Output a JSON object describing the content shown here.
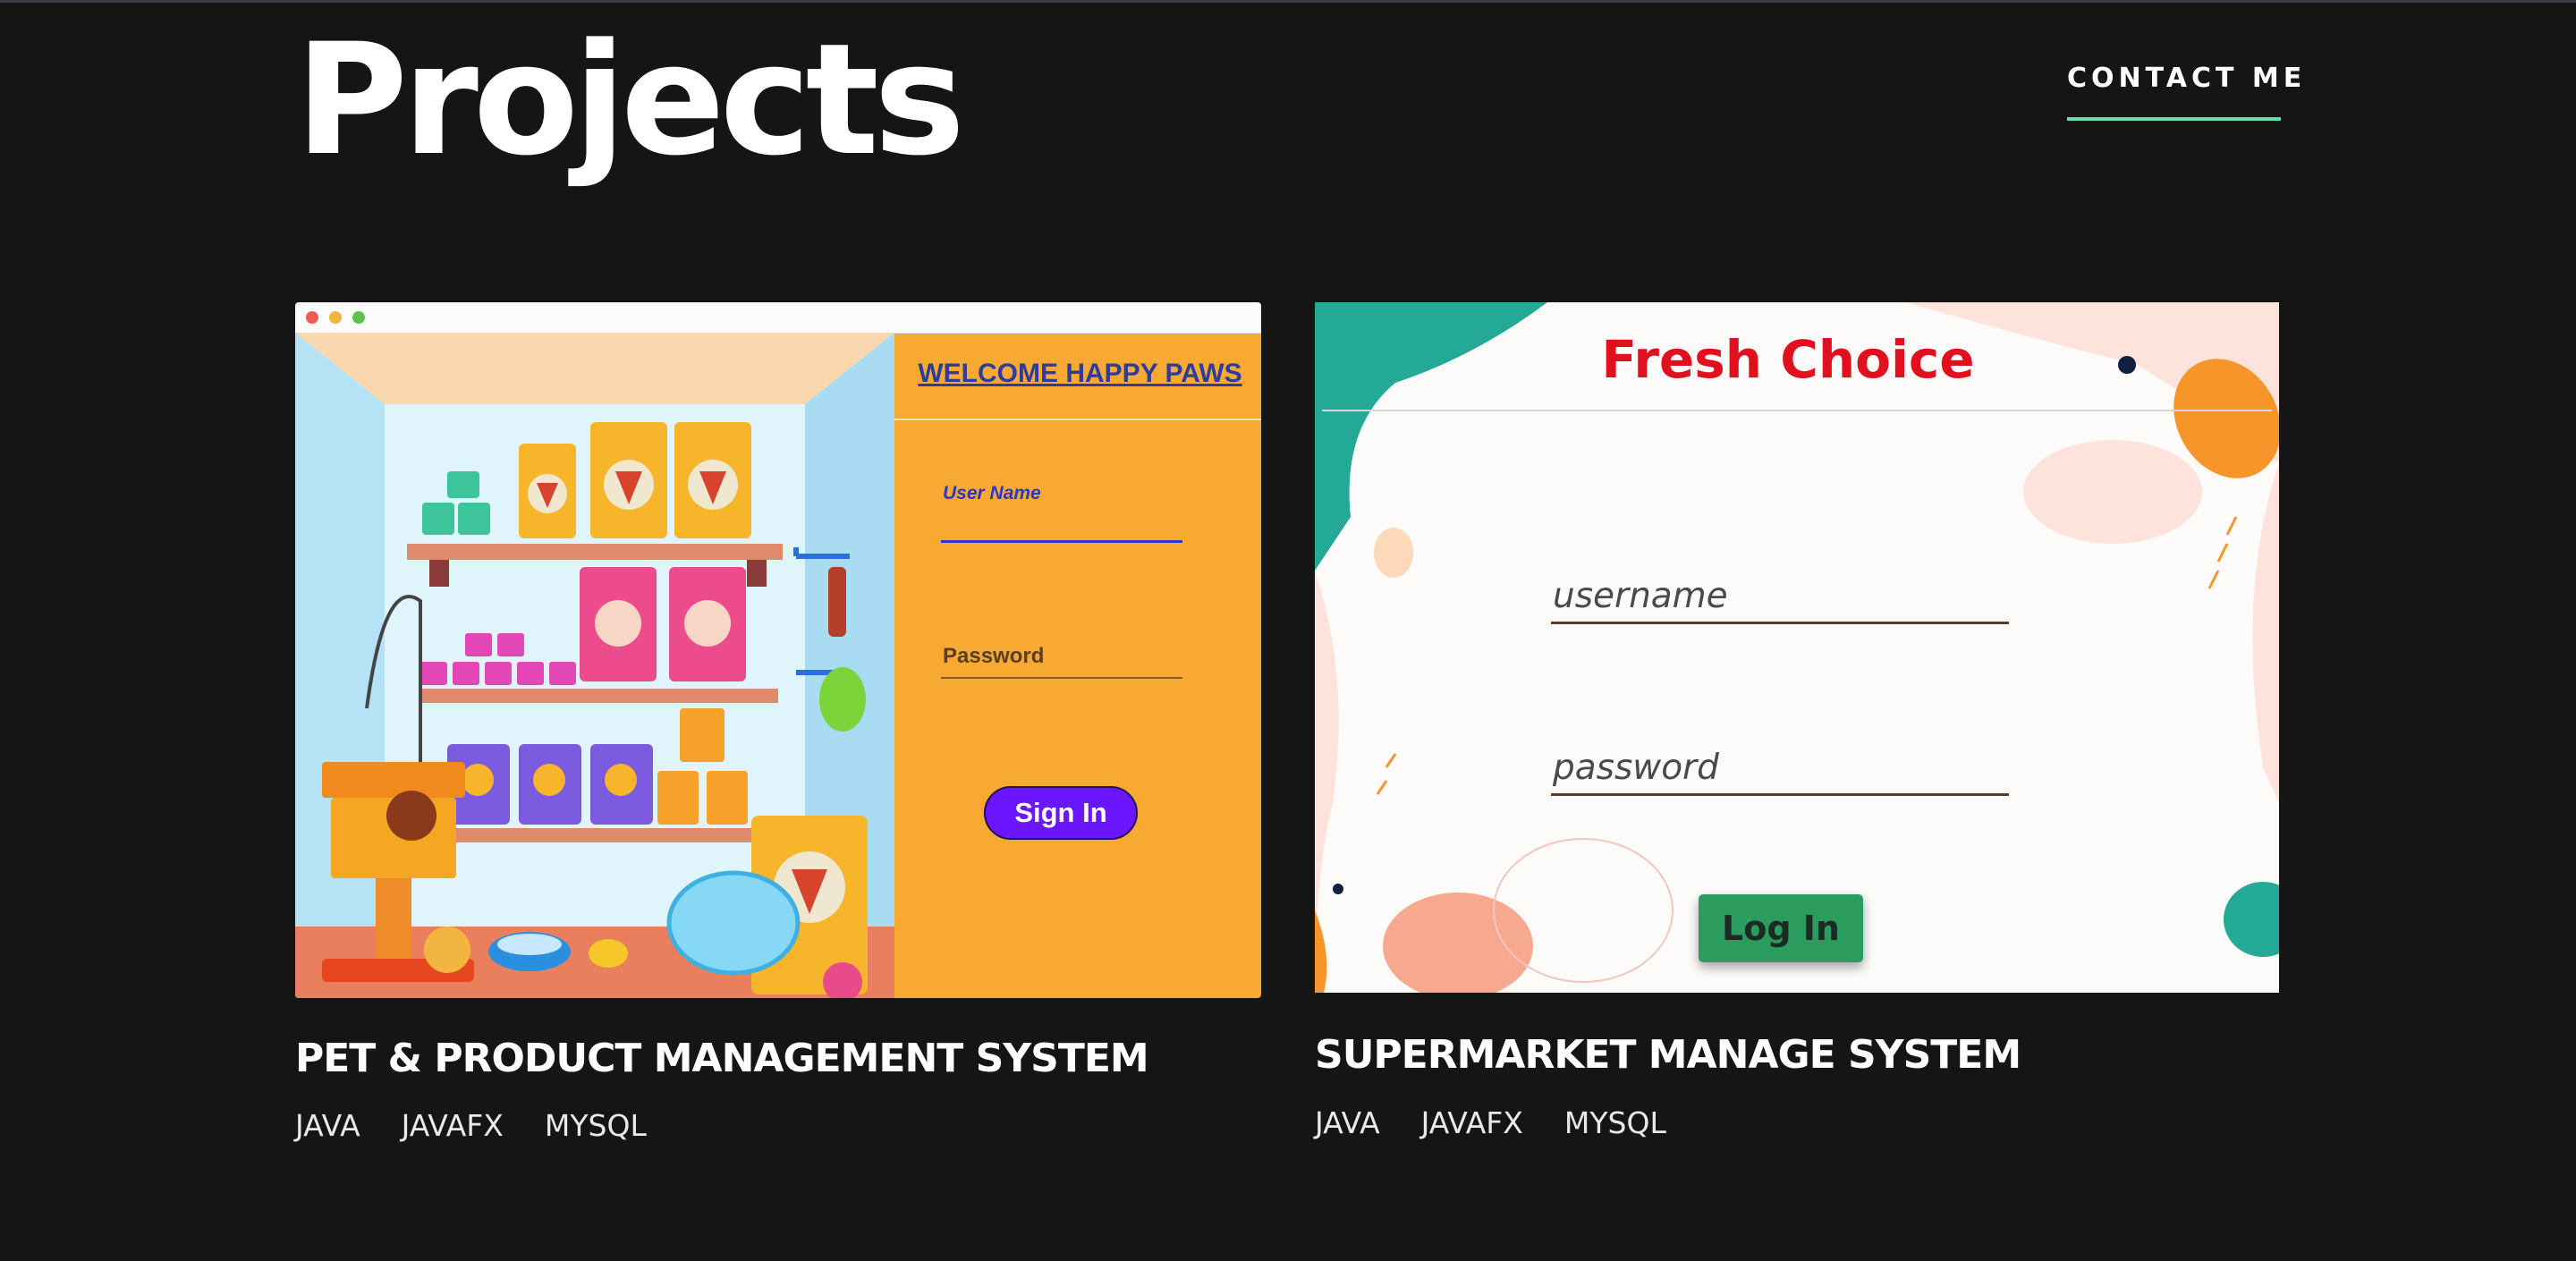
{
  "header": {
    "title": "Projects",
    "contact_label": "CONTACT ME",
    "accent_color": "#5ee2a7"
  },
  "projects": [
    {
      "title": "PET & PRODUCT MANAGEMENT SYSTEM",
      "tags": [
        "JAVA",
        "JAVAFX",
        "MYSQL"
      ],
      "screenshot": {
        "heading": "WELCOME  HAPPY PAWS",
        "username_label": "User Name",
        "password_label": "Password",
        "button_label": "Sign In",
        "panel_color": "#f7a931",
        "button_color": "#6a16ff"
      }
    },
    {
      "title": "SUPERMARKET MANAGE SYSTEM",
      "tags": [
        "JAVA",
        "JAVAFX",
        "MYSQL"
      ],
      "screenshot": {
        "heading": "Fresh Choice",
        "username_placeholder": "username",
        "password_placeholder": "password",
        "button_label": "Log In",
        "heading_color": "#e0101e",
        "button_color": "#2c9b5e"
      }
    }
  ]
}
